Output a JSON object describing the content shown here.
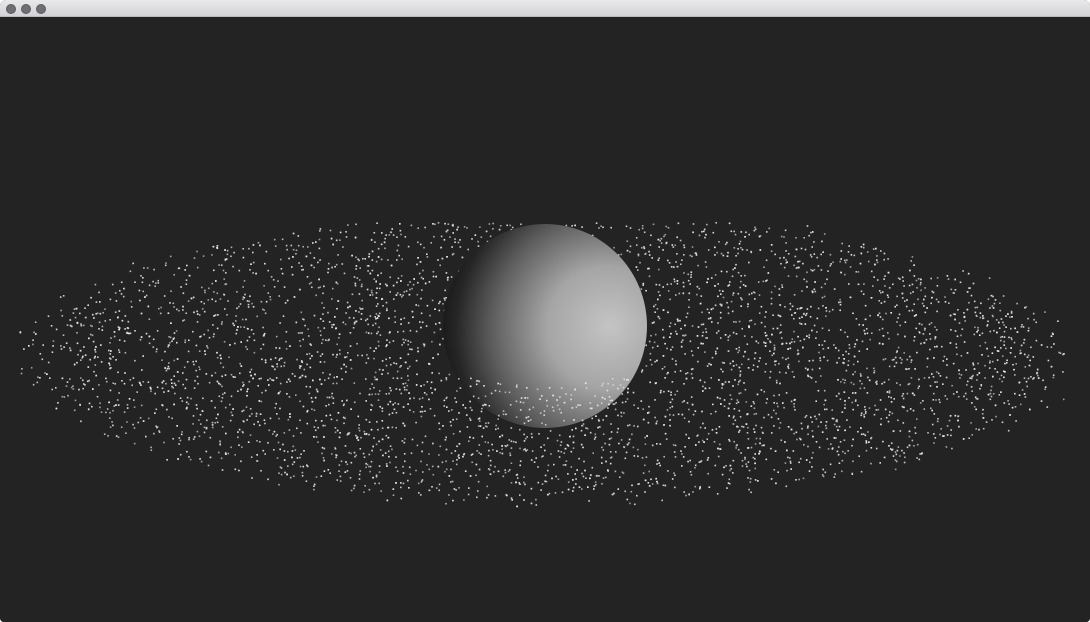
{
  "window": {
    "title": "",
    "background_color": "#232323",
    "titlebar_color": "#dcdbde",
    "button_color": "#6f6e72"
  },
  "scene": {
    "objects": [
      {
        "name": "sphere",
        "color_lit": "#bdbdbd",
        "color_shadow": "#111111"
      },
      {
        "name": "particle-ring",
        "particle_color": "#e8e8e8"
      }
    ]
  }
}
